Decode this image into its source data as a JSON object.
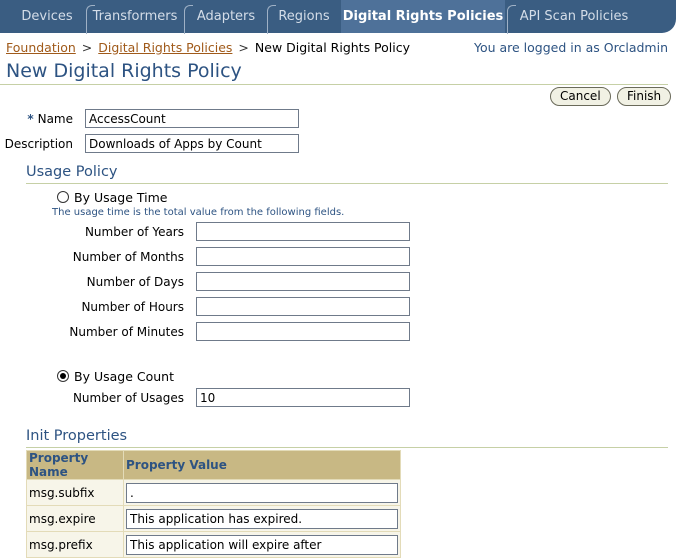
{
  "tabs": [
    {
      "label": "Devices",
      "active": false
    },
    {
      "label": "Transformers",
      "active": false
    },
    {
      "label": "Adapters",
      "active": false
    },
    {
      "label": "Regions",
      "active": false
    },
    {
      "label": "Digital Rights Policies",
      "active": true
    },
    {
      "label": "API Scan Policies",
      "active": false
    }
  ],
  "breadcrumb": {
    "items": [
      "Foundation",
      "Digital Rights Policies"
    ],
    "separator": ">",
    "current": "New Digital Rights Policy"
  },
  "user_status": "You are logged in as Orcladmin",
  "page_title": "New Digital Rights Policy",
  "buttons": {
    "cancel": "Cancel",
    "finish": "Finish"
  },
  "form": {
    "required_marker": "*",
    "name": {
      "label": "Name",
      "value": "AccessCount"
    },
    "description": {
      "label": "Description",
      "value": "Downloads of Apps by Count"
    }
  },
  "usage_policy": {
    "title": "Usage Policy",
    "by_time": {
      "label": "By Usage Time",
      "selected": false,
      "hint": "The usage time is the total value from the following fields.",
      "fields": [
        {
          "label": "Number of Years",
          "value": ""
        },
        {
          "label": "Number of Months",
          "value": ""
        },
        {
          "label": "Number of Days",
          "value": ""
        },
        {
          "label": "Number of Hours",
          "value": ""
        },
        {
          "label": "Number of Minutes",
          "value": ""
        }
      ]
    },
    "by_count": {
      "label": "By Usage Count",
      "selected": true,
      "field": {
        "label": "Number of Usages",
        "value": "10"
      }
    }
  },
  "init_properties": {
    "title": "Init Properties",
    "columns": [
      "Property Name",
      "Property Value"
    ],
    "rows": [
      {
        "name": "msg.subfix",
        "value": "."
      },
      {
        "name": "msg.expire",
        "value": "This application has expired."
      },
      {
        "name": "msg.prefix",
        "value": "This application will expire after"
      }
    ]
  },
  "colors": {
    "brand_blue": "#2d5382",
    "tab_bar": "#3a5d82",
    "link": "#a05a1a",
    "table_header": "#c8b884"
  }
}
